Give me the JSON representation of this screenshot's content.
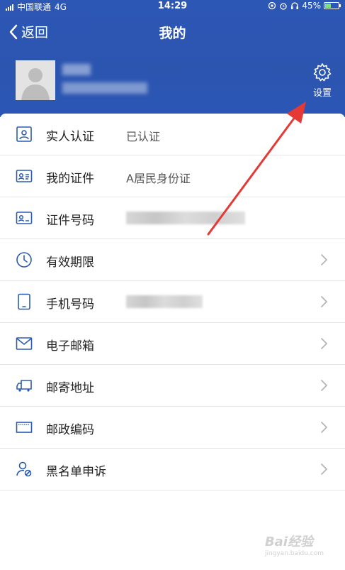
{
  "status_bar": {
    "carrier": "中国联通",
    "network": "4G",
    "time": "14:29",
    "battery": "45%",
    "battery_level": 0.45
  },
  "nav": {
    "back_label": "返回",
    "title": "我的"
  },
  "profile": {
    "settings_label": "设置"
  },
  "menu": [
    {
      "icon": "id-card-person-icon",
      "label": "实人认证",
      "value": "已认证",
      "chevron": false
    },
    {
      "icon": "id-card-icon",
      "label": "我的证件",
      "value": "A居民身份证",
      "chevron": false
    },
    {
      "icon": "id-number-icon",
      "label": "证件号码",
      "value": "",
      "chevron": false
    },
    {
      "icon": "clock-icon",
      "label": "有效期限",
      "value": "",
      "chevron": true
    },
    {
      "icon": "phone-icon",
      "label": "手机号码",
      "value": "",
      "chevron": true
    },
    {
      "icon": "mail-icon",
      "label": "电子邮箱",
      "value": "",
      "chevron": true
    },
    {
      "icon": "truck-icon",
      "label": "邮寄地址",
      "value": "",
      "chevron": true
    },
    {
      "icon": "postcode-icon",
      "label": "邮政编码",
      "value": "",
      "chevron": true
    },
    {
      "icon": "blacklist-user-icon",
      "label": "黑名单申诉",
      "value": "",
      "chevron": true
    }
  ],
  "watermark": {
    "text": "Bai经验",
    "sub": "jingyan.baidu.com"
  },
  "colors": {
    "header_blue": "#2c55b0",
    "icon_blue": "#2b5bb0",
    "annotation_arrow": "#e53935"
  }
}
